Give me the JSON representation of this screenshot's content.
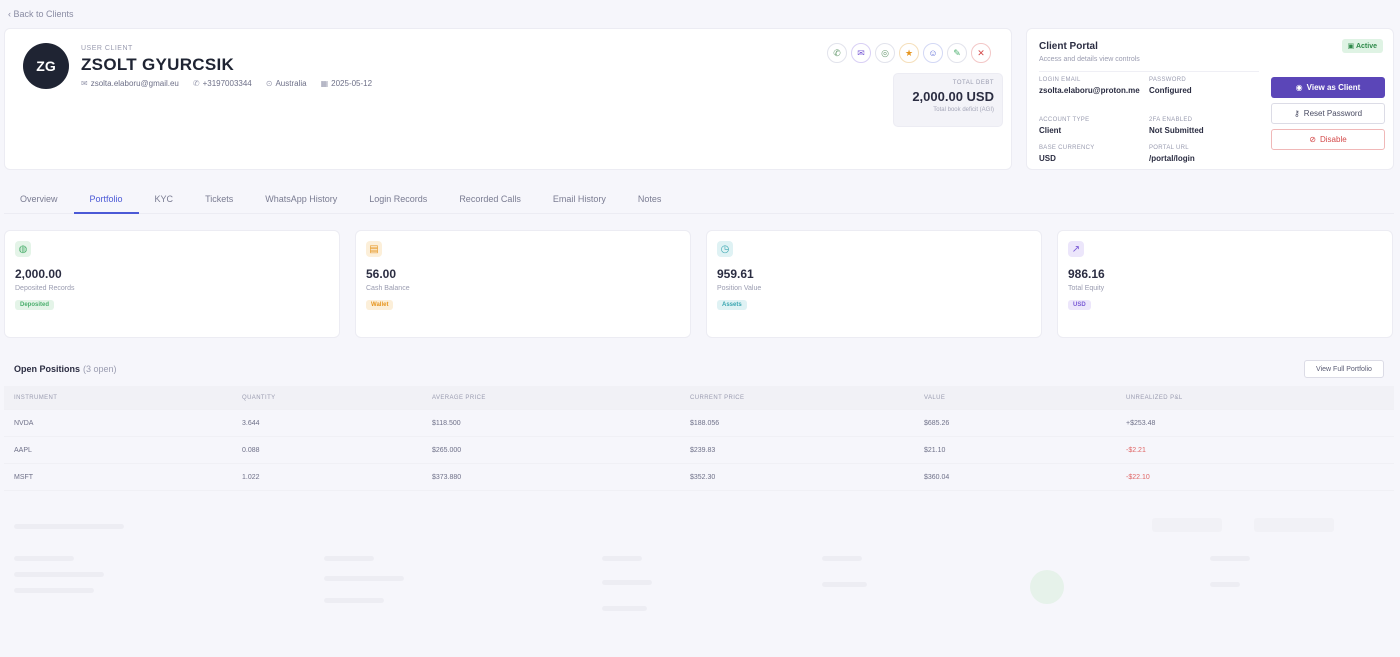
{
  "nav": {
    "back_label": "‹ Back to Clients"
  },
  "client": {
    "initials": "ZG",
    "kicker": "USER CLIENT",
    "name": "ZSOLT GYURCSIK",
    "email": "zsolta.elaboru@gmail.eu",
    "phone": "+3197003344",
    "country": "Australia",
    "date": "2025-05-12"
  },
  "balance": {
    "label": "TOTAL DEBT",
    "value": "2,000.00 USD",
    "sub": "Total book deficit (AGI)"
  },
  "portal": {
    "title": "Client Portal",
    "subtitle": "Access and details view controls",
    "badge": "Active",
    "fields": [
      {
        "label": "LOGIN EMAIL",
        "value": "zsolta.elaboru@proton.me"
      },
      {
        "label": "PASSWORD",
        "value": "Configured"
      },
      {
        "label": "ACCOUNT TYPE",
        "value": "Client"
      },
      {
        "label": "2FA ENABLED",
        "value": "Not Submitted"
      },
      {
        "label": "BASE CURRENCY",
        "value": "USD"
      },
      {
        "label": "PORTAL URL",
        "value": "/portal/login"
      }
    ],
    "buttons": {
      "view_as_client": "View as Client",
      "reset_password": "Reset Password",
      "disable": "Disable"
    }
  },
  "tabs": [
    {
      "label": "Overview",
      "active": false
    },
    {
      "label": "Portfolio",
      "active": true
    },
    {
      "label": "KYC",
      "active": false
    },
    {
      "label": "Tickets",
      "active": false
    },
    {
      "label": "WhatsApp History",
      "active": false
    },
    {
      "label": "Login Records",
      "active": false
    },
    {
      "label": "Recorded Calls",
      "active": false
    },
    {
      "label": "Email History",
      "active": false
    },
    {
      "label": "Notes",
      "active": false
    }
  ],
  "stats": [
    {
      "value": "2,000.00",
      "label": "Deposited Records",
      "chip": "Deposited",
      "icon": "coins-icon",
      "color": "#4caf6e",
      "bg": "#e4f4e8"
    },
    {
      "value": "56.00",
      "label": "Cash Balance",
      "chip": "Wallet",
      "icon": "wallet-icon",
      "color": "#e6951e",
      "bg": "#fcefd9"
    },
    {
      "value": "959.61",
      "label": "Position Value",
      "chip": "Assets",
      "icon": "clock-icon",
      "color": "#3aa6b0",
      "bg": "#dff2f4"
    },
    {
      "value": "986.16",
      "label": "Total Equity",
      "chip": "USD",
      "icon": "chart-icon",
      "color": "#7b5cd6",
      "bg": "#ece6fb"
    }
  ],
  "positions": {
    "title": "Open Positions",
    "count": "(3 open)",
    "full_button": "View Full Portfolio",
    "columns": [
      "INSTRUMENT",
      "QUANTITY",
      "AVERAGE PRICE",
      "CURRENT PRICE",
      "VALUE",
      "UNREALIZED P&L"
    ],
    "rows": [
      [
        "NVDA",
        "3.644",
        "$118.500",
        "$188.056",
        "$685.26",
        "+$253.48"
      ],
      [
        "AAPL",
        "0.088",
        "$265.000",
        "$239.83",
        "$21.10",
        "-$2.21"
      ],
      [
        "MSFT",
        "1.022",
        "$373.880",
        "$352.30",
        "$360.04",
        "-$22.10"
      ]
    ]
  }
}
